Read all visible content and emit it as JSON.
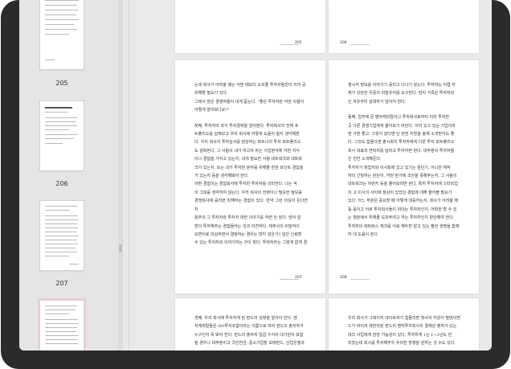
{
  "sidebar": {
    "thumbnails": [
      {
        "page": "205"
      },
      {
        "page": "206"
      },
      {
        "page": "207"
      },
      {
        "page": ""
      }
    ]
  },
  "pages": {
    "p205_folio": "205",
    "p206_folio": "206",
    "p207_folio": "207",
    "p208_folio": "208",
    "p207_lines": [
      "는데 회사가 어려울 때는 어떤 때보다 도와줄 투자자들만이 의미 공",
      "유해할 필요가 있다.",
      "그래서 많은 경영자들이 내게 묻는다. \"좋은 투자자란 어떤 사람이",
      "어떻게 알아보나요?\"",
      "",
      "첫째, 투자자의 과거 투자경력을 알아본다. 투자회사의 전체 포",
      "트폴리오를 살펴보고 우리 회사에 어떻게 도움이 될지 생각해본",
      "다. 우리 회사의 투자심사를 담당하는 파트너의 투자 포트폴리오",
      "도 살펴본다. 그 사람이 내가 하고자 하는 사업분야에 어떤 지식",
      "이나 경험을 가지고 있는지, 내게 필요한 사람 네트워크와 네트워",
      "크가 있는지, 또는 내가 투자한 분야를 위해줄 만한 포인트 경험을",
      "가 있는지 등을 생각해봐야 한다.",
      "어떤 경험이는 경험회사에 투자한 투자자를 의미한다. 나는 억",
      "의 그대를 생각하지 않는다. 우리 회사의 전략이나 필요한 정보를",
      "경쟁회사에 흘리면 피해하는 경험이 있다. 만약 그런 의심이 든다면 차",
      "용주의 그 투자자와 투자자 대한 이야기를 하면 안 된다. 많이 알",
      "면이 투자해주는 경험들어는 것과 의견하다. 재주사의 비밀적이",
      "보면이로 의심하면서 결정하는 경우는 많지 않은가? 일단 신뢰할",
      "수 있는 투자자와 이야기하는 것이 맞다. 투자자라는 그렇게 없게 경"
    ],
    "p208_lines": [
      "챙시석 정보를 이야기기 흘리고 다니기 않는다. 투자하는 어렵 자",
      "체가 상당한 우중의 비밀유지를 요구한다. 담지 가족은 투자자와",
      "인 자유부터 삼대하기 앞이어 한다.",
      "",
      "둘째, 업무에 문 벤처캐피탈이나 투자회사로부터 이미 투자한",
      "곳 다른 경영기업에게 물어보기 바란다. 이미 있고 있는 기업이라",
      "면 가장 좋고, 그렇지 않다면 단 한번 지방을 충해 소개받아도 좋",
      "다. 그것도 힘들다면 출시회의 투자자에게 다른 투자 포트폴리오",
      "회사 대표의 연락처를 달라고 투자하면 된다. 대부분의 투자자들",
      "은 친한 소개해준다.",
      "투자자가 창업자와 이사회에 있고 있기는 판단기, 어니한 재작",
      "하의 긴밀하는 판단이, 어떤 판가에 조언을 중해주는지, 그 사람의",
      "네트워크는 어떤지 등을 물어보려면 된다. 특히 투자자에 스타트업",
      "의 고 이사의 사이에 정상이 있었던 경험에 대해 물어볼 필요가",
      "있다. 어느 부분은 중요할 때 어떻게 대응하는지, 회사가 어려울 때",
      "등 등이고 어로 투자회사들이 위대는 투자자인지, 어떠한 할 수 있",
      "는 월된에서 위해줄 도와주려고 하는 투자자인지 판단해야 한다.",
      "투자자의 레퍼런스 체크를 어로 해두면 알고 있는 훨씬 생명을 함께",
      "하 데 도움이 된다."
    ],
    "p209_lines": [
      "셋째, 우리 회사에 투자하게 된 펀드의 성향을 알아야 한다. 벤",
      "처캐피탈들은 OO투자조합이라는 이름으로 여러 펀드의 출자자가",
      "누구인지 꼭 봐야 한다. 펀드의 출자자 일곱 수익의 대가원이 포함",
      "될 경우나 대부분이고 국민연금, 중소기업청 모태펀드, 산업은행과"
    ],
    "p210_lines": [
      "우리 회사가 그레이지 데이트하기 힘들리면 회사의 지원이 필떤이면",
      "드가 바이러 제한되된 펀드리 벤처투자회사의 결재성 출자가 있는",
      "데즈 사업에게 담당 가능성이 있다. 투자하게 1는 1~2년도 한",
      "되었는데 회사를 투자해주우 두리한 방향을 원하는 것 수도 있다."
    ]
  }
}
